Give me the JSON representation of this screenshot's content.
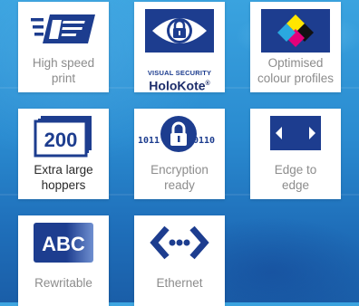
{
  "features": [
    {
      "label": "High speed\nprint",
      "icon": "high-speed-print-icon"
    },
    {
      "label": "",
      "icon": "visual-security-eye-lock-icon",
      "brand_small": "VISUAL SECURITY",
      "brand_big": "HoloKote",
      "brand_mark": "®"
    },
    {
      "label": "Optimised\ncolour profiles",
      "icon": "colour-diamond-icon"
    },
    {
      "label": "Extra large\nhoppers",
      "icon": "card-stack-icon",
      "icon_text": "200"
    },
    {
      "label": "Encryption\nready",
      "icon": "padlock-binary-icon",
      "icon_text_left": "1011",
      "icon_text_right": "0110"
    },
    {
      "label": "Edge to\nedge",
      "icon": "edge-to-edge-arrows-icon"
    },
    {
      "label": "Rewritable",
      "icon": "rewritable-card-icon",
      "icon_text": "ABC"
    },
    {
      "label": "Ethernet",
      "icon": "ethernet-icon"
    }
  ],
  "colors": {
    "brand_blue": "#1d3d8f",
    "caption_grey": "#8c8c8c",
    "caption_dark": "#2a2a2a",
    "cyan": "#2aa8e0",
    "magenta": "#e2007a",
    "yellow": "#ffe600",
    "black": "#111111"
  }
}
